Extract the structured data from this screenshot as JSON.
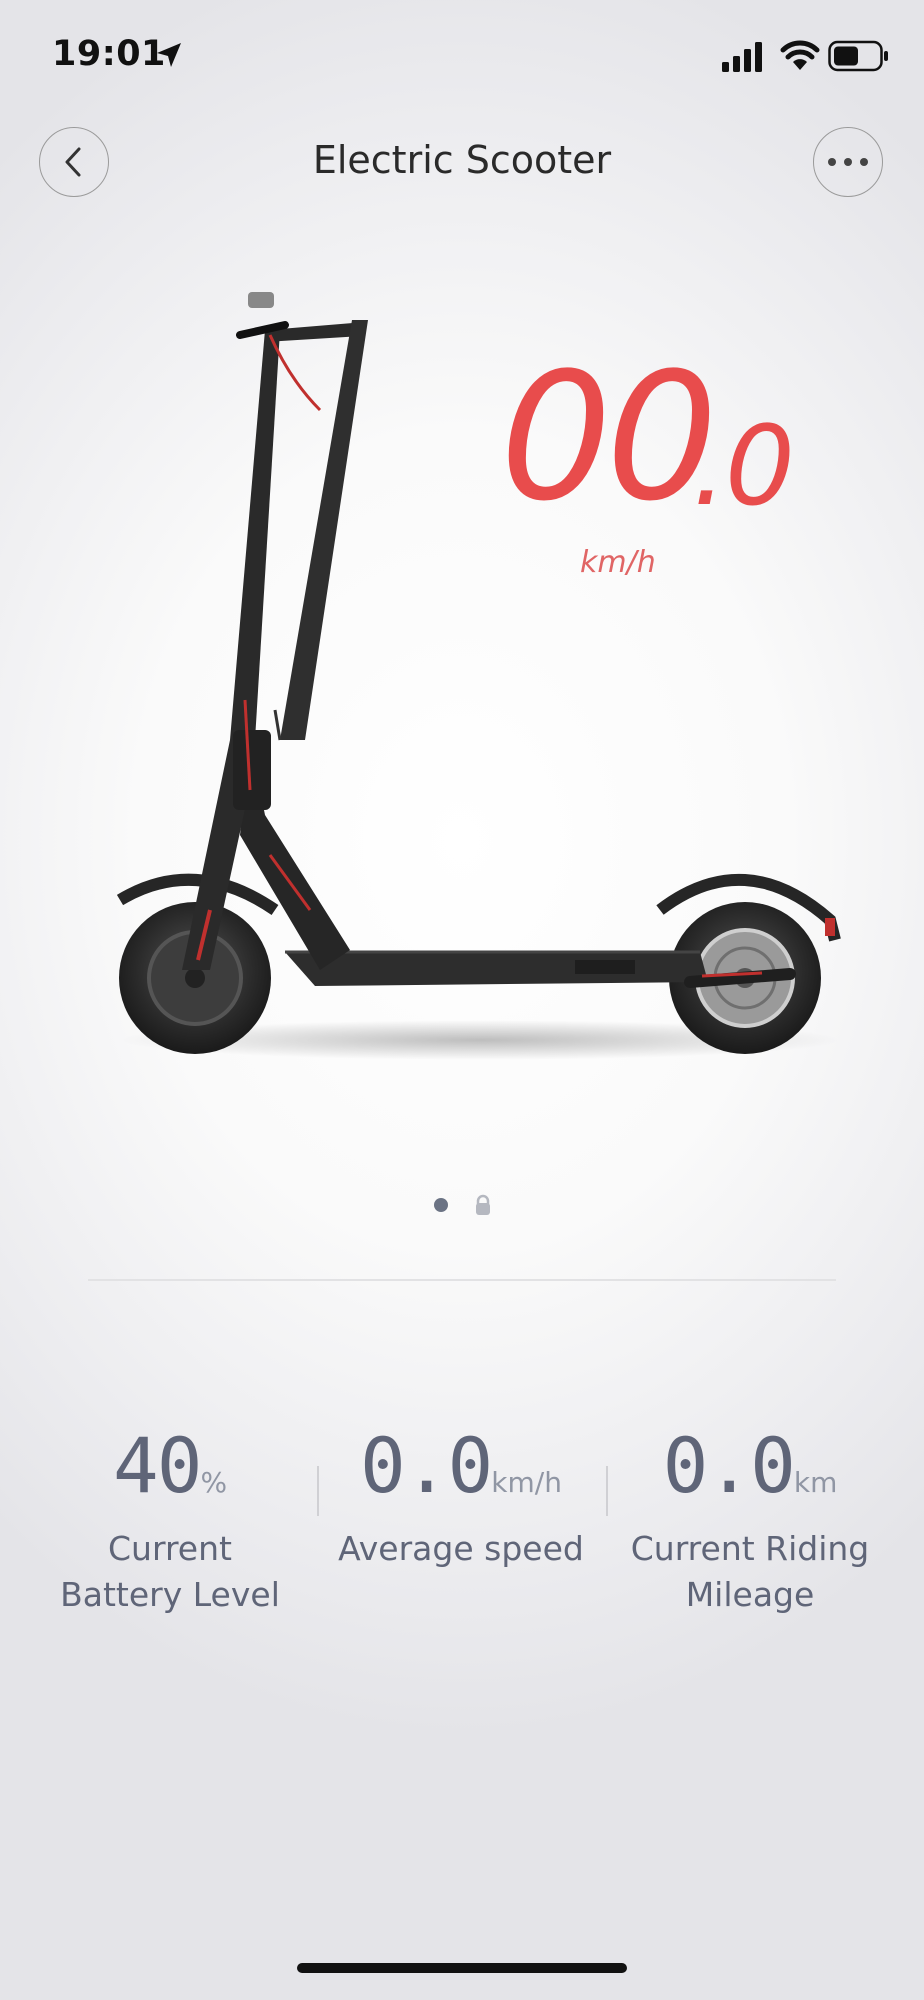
{
  "status_bar": {
    "time": "19:01",
    "icons": [
      "location-arrow-icon",
      "cellular-signal-icon",
      "wifi-icon",
      "battery-icon"
    ]
  },
  "header": {
    "title": "Electric Scooter",
    "back_icon": "chevron-left-icon",
    "more_icon": "more-dots-icon"
  },
  "speed": {
    "integer": "00",
    "decimal": ".0",
    "unit": "km/h",
    "color": "#e84c4c"
  },
  "pager": {
    "dots": [
      "active-dot",
      "lock-icon"
    ]
  },
  "stats": [
    {
      "value": "40",
      "unit": "%",
      "label_line1": "Current",
      "label_line2": "Battery Level"
    },
    {
      "value": "0.0",
      "unit": "km/h",
      "label_line1": "Average speed",
      "label_line2": ""
    },
    {
      "value": "0.0",
      "unit": "km",
      "label_line1": "Current Riding",
      "label_line2": "Mileage"
    }
  ],
  "colors": {
    "accent": "#e84c4c",
    "stat_text": "#5f6578"
  }
}
